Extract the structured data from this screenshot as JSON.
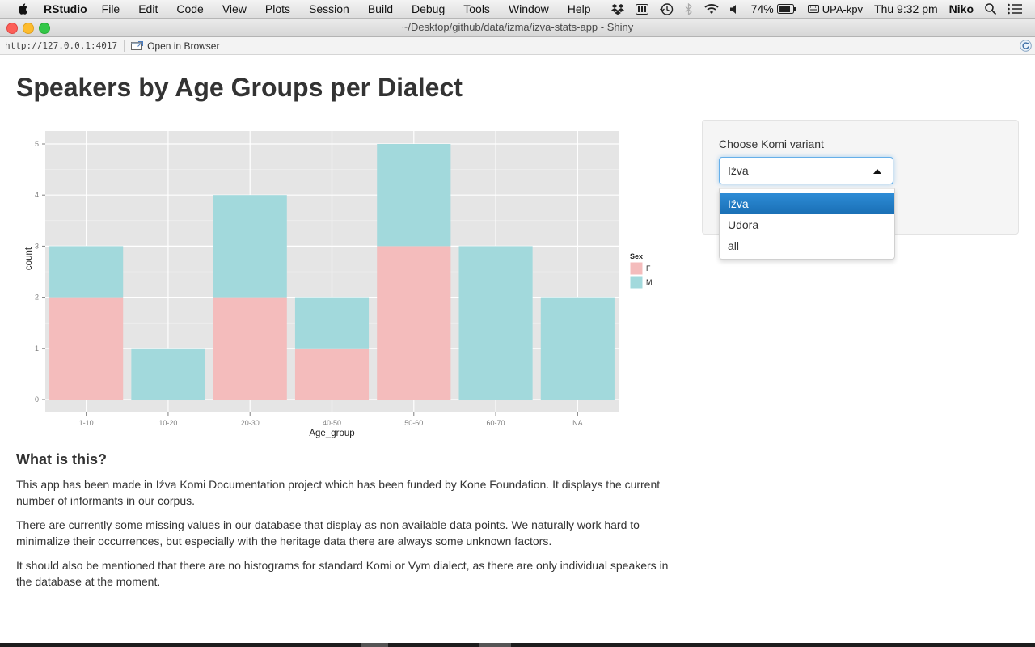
{
  "menubar": {
    "app_name": "RStudio",
    "menus": [
      "File",
      "Edit",
      "Code",
      "View",
      "Plots",
      "Session",
      "Build",
      "Debug",
      "Tools",
      "Window",
      "Help"
    ],
    "battery": "74%",
    "keyboard": "UPA-kpv",
    "clock": "Thu 9:32 pm",
    "user": "Niko"
  },
  "window": {
    "title": "~/Desktop/github/data/izma/izva-stats-app - Shiny"
  },
  "toolbar": {
    "url": "http://127.0.0.1:4017",
    "open_label": "Open in Browser"
  },
  "page": {
    "title": "Speakers by Age Groups per Dialect",
    "section_heading": "What is this?",
    "paragraphs": [
      "This app has been made in Iźva Komi Documentation project which has been funded by Kone Foundation. It displays the current number of informants in our corpus.",
      "There are currently some missing values in our database that display as non available data points. We naturally work hard to minimalize their occurrences, but especially with the heritage data there are always some unknown factors.",
      "It should also be mentioned that there are no histograms for standard Komi or Vym dialect, as there are only individual speakers in the database at the moment."
    ]
  },
  "sidebar": {
    "select_label": "Choose Komi variant",
    "selected": "Iźva",
    "options": [
      "Iźva",
      "Udora",
      "all"
    ]
  },
  "chart_data": {
    "type": "bar",
    "stacked": true,
    "categories": [
      "1-10",
      "10-20",
      "20-30",
      "40-50",
      "50-60",
      "60-70",
      "NA"
    ],
    "series": [
      {
        "name": "F",
        "values": [
          2,
          0,
          2,
          1,
          3,
          0,
          0
        ],
        "color": "#f4bcbc"
      },
      {
        "name": "M",
        "values": [
          1,
          1,
          2,
          1,
          2,
          3,
          2
        ],
        "color": "#a2d9dc"
      }
    ],
    "xlabel": "Age_group",
    "ylabel": "count",
    "ylim": [
      0,
      5
    ],
    "yticks": [
      0,
      1,
      2,
      3,
      4,
      5
    ],
    "legend_title": "Sex",
    "legend_position": "right",
    "grid": true,
    "panel_bg": "#e5e5e5"
  },
  "colors": {
    "select_highlight": "#1e7bc6",
    "focus_border": "#66afe9"
  }
}
